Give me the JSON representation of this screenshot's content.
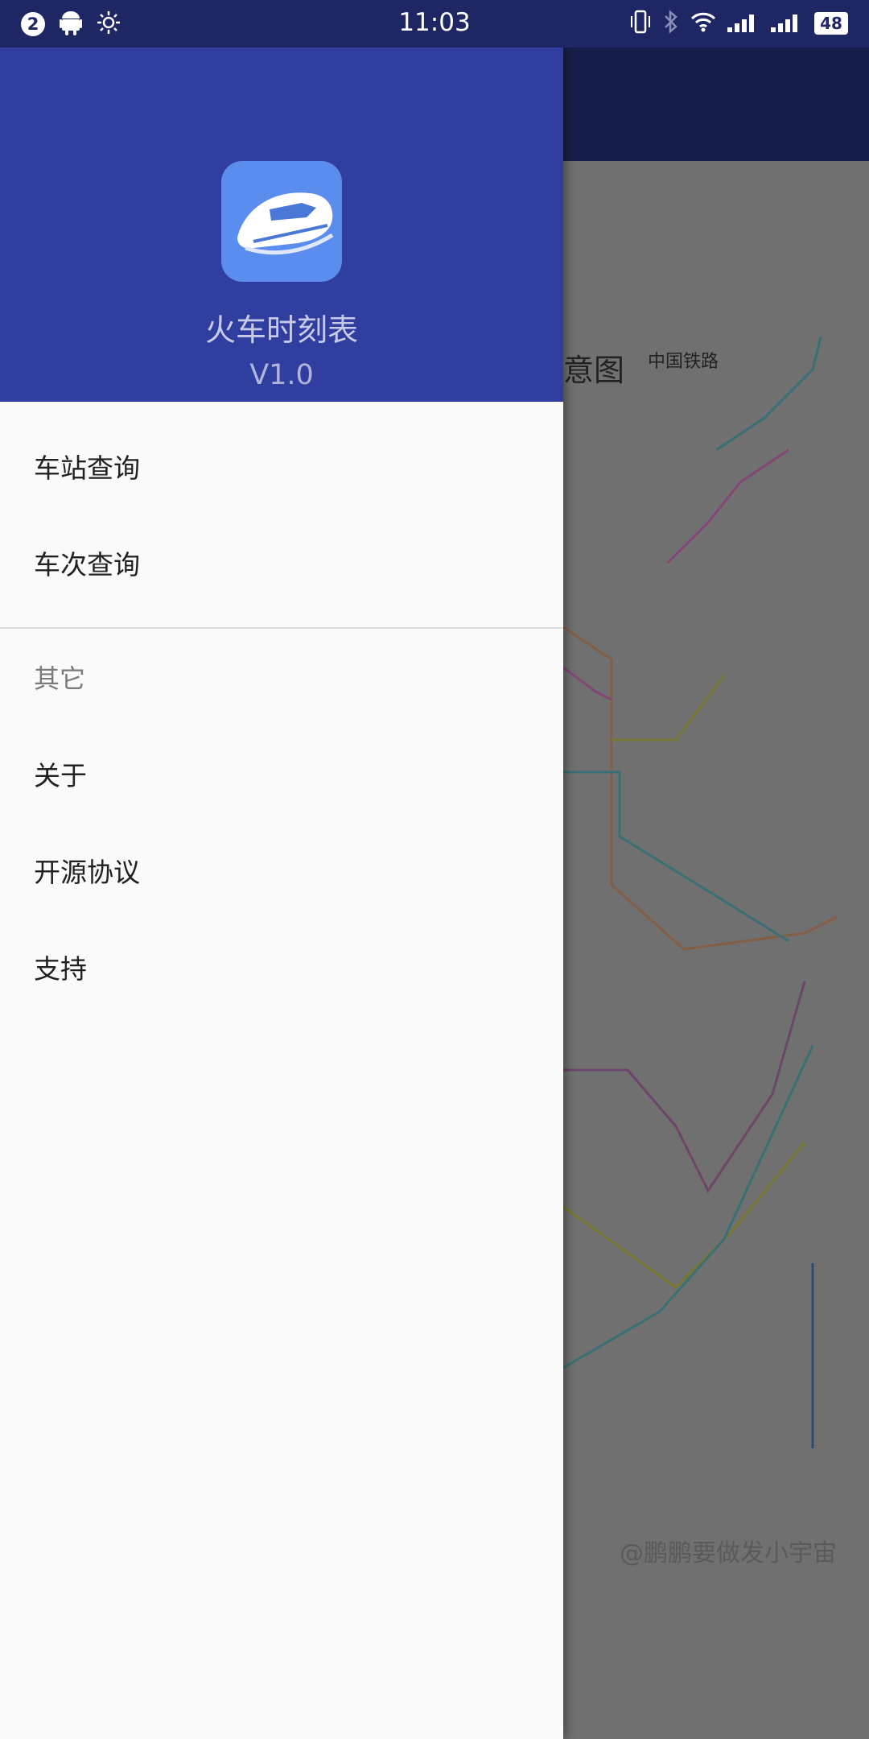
{
  "status_bar": {
    "notification_count": "2",
    "time": "11:03",
    "battery": "48"
  },
  "drawer": {
    "app_name": "火车时刻表",
    "version": "V1.0",
    "primary_items": [
      "车站查询",
      "车次查询"
    ],
    "section_title": "其它",
    "secondary_items": [
      "关于",
      "开源协议",
      "支持"
    ]
  },
  "background": {
    "map_title": "意图",
    "map_logo": "中国铁路",
    "watermark": "@鹏鹏要做发小宇宙"
  },
  "colors": {
    "status_bar": "#1f2664",
    "drawer_header": "#303f9f",
    "app_icon": "#5b8def"
  }
}
